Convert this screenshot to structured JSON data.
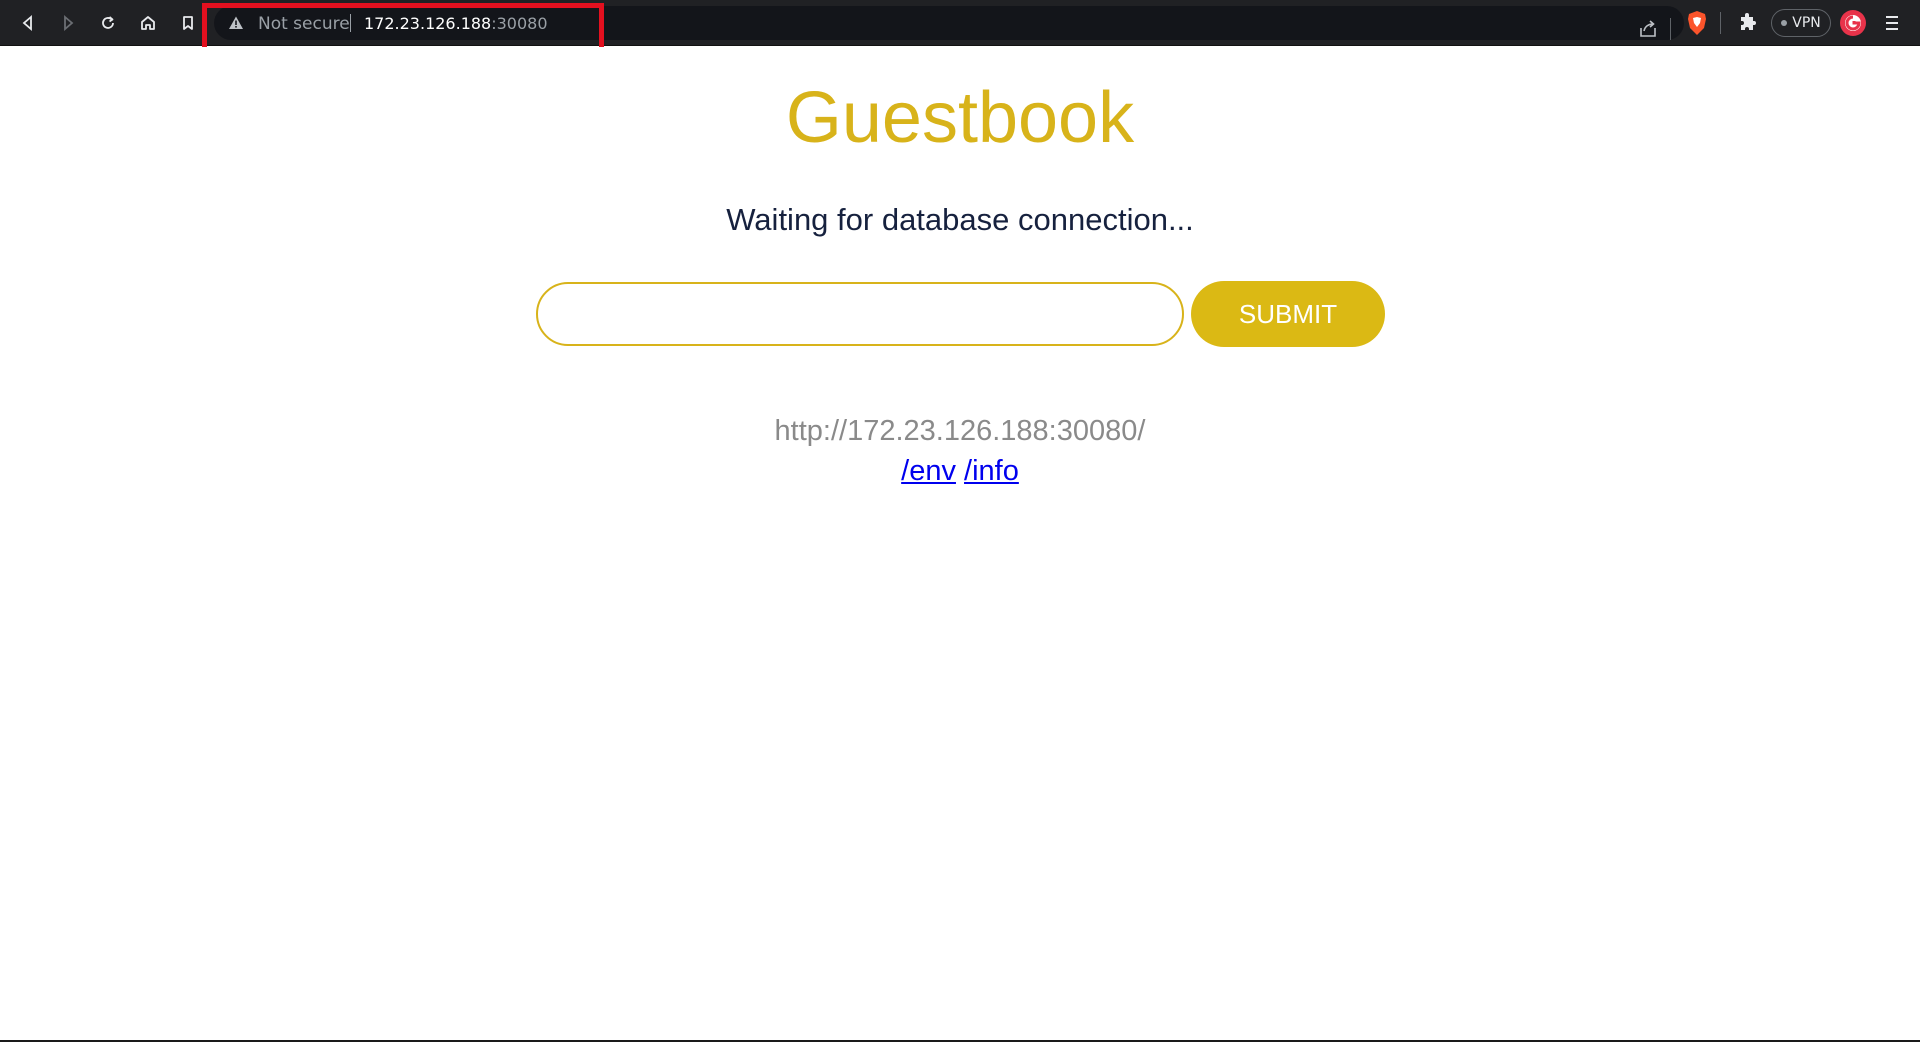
{
  "browser": {
    "security_label": "Not secure",
    "url_host": "172.23.126.188",
    "url_port": ":30080",
    "vpn_label": "VPN"
  },
  "page": {
    "title": "Guestbook",
    "status": "Waiting for database connection...",
    "entry_placeholder": "",
    "submit_label": "SUBMIT",
    "host_url": "http://172.23.126.188:30080/",
    "links": [
      {
        "label": "/env"
      },
      {
        "label": "/info"
      }
    ]
  },
  "colors": {
    "accent": "#d8b31a",
    "button": "#dbb914",
    "annotation": "#e3101f",
    "link": "#0000ee"
  }
}
